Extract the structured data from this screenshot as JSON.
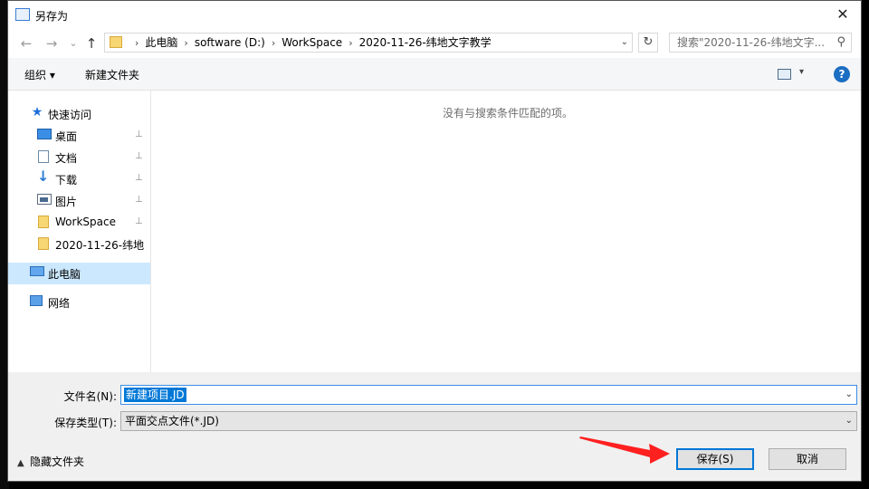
{
  "window": {
    "title": "另存为",
    "close_glyph": "✕"
  },
  "nav": {
    "back_glyph": "←",
    "forward_glyph": "→",
    "recent_glyph": "⌄",
    "up_glyph": "↑",
    "breadcrumb": [
      "此电脑",
      "software (D:)",
      "WorkSpace",
      "2020-11-26-纬地文字教学"
    ],
    "refresh_glyph": "↻",
    "search_placeholder": "搜索\"2020-11-26-纬地文字...",
    "search_glyph": "⚲"
  },
  "toolbar": {
    "organize": "组织 ▾",
    "new_folder": "新建文件夹",
    "view_caret": "▾",
    "help": "?"
  },
  "sidebar": {
    "quick_access": "快速访问",
    "items": [
      {
        "label": "桌面",
        "icon": "desktop-icon"
      },
      {
        "label": "文档",
        "icon": "document-icon"
      },
      {
        "label": "下载",
        "icon": "download-icon"
      },
      {
        "label": "图片",
        "icon": "pictures-icon"
      },
      {
        "label": "WorkSpace",
        "icon": "folder-icon"
      },
      {
        "label": "2020-11-26-纬地",
        "icon": "folder-icon"
      }
    ],
    "this_pc": "此电脑",
    "network": "网络",
    "pin_glyph": "📌"
  },
  "content": {
    "empty_message": "没有与搜索条件匹配的项。"
  },
  "form": {
    "filename_label": "文件名(N):",
    "filename_value": "新建项目.JD",
    "filetype_label": "保存类型(T):",
    "filetype_value": "平面交点文件(*.JD)",
    "dropdown_glyph": "⌄"
  },
  "footer": {
    "hide_folders": "隐藏文件夹",
    "save": "保存(S)",
    "cancel": "取消"
  },
  "colors": {
    "accent": "#0078d7",
    "annotation_arrow": "#ff2020",
    "selection": "#cce8ff"
  }
}
